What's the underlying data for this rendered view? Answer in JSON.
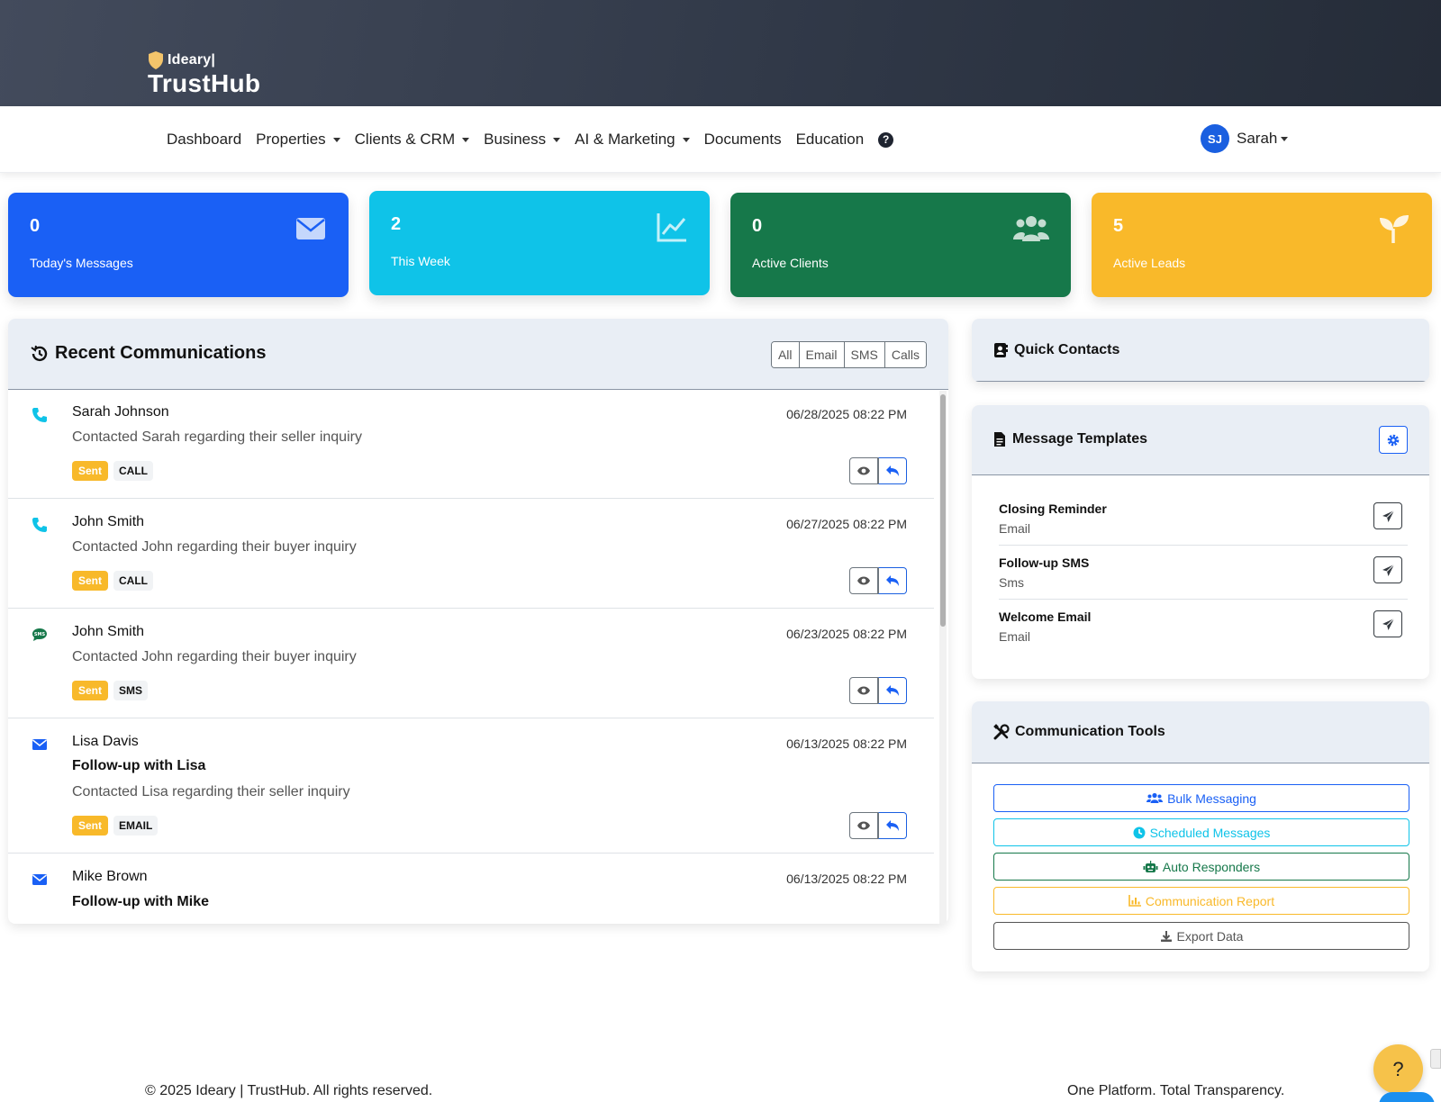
{
  "brand": {
    "small": "Ideary|",
    "big": "TrustHub"
  },
  "nav": {
    "items": [
      {
        "label": "Dashboard",
        "dropdown": false
      },
      {
        "label": "Properties",
        "dropdown": true
      },
      {
        "label": "Clients & CRM",
        "dropdown": true
      },
      {
        "label": "Business",
        "dropdown": true
      },
      {
        "label": "AI & Marketing",
        "dropdown": true
      },
      {
        "label": "Documents",
        "dropdown": false
      },
      {
        "label": "Education",
        "dropdown": false
      }
    ],
    "help": "?",
    "user": {
      "initials": "SJ",
      "name": "Sarah"
    }
  },
  "stats": [
    {
      "value": "0",
      "label": "Today's Messages",
      "color": "#1a60f5",
      "icon": "envelope-icon"
    },
    {
      "value": "2",
      "label": "This Week",
      "color": "#0fc3e8",
      "icon": "chart-line-icon"
    },
    {
      "value": "0",
      "label": "Active Clients",
      "color": "#16784a",
      "icon": "users-icon"
    },
    {
      "value": "5",
      "label": "Active Leads",
      "color": "#f9b92a",
      "icon": "seedling-icon"
    }
  ],
  "recent": {
    "title": "Recent Communications",
    "filters": [
      "All",
      "Email",
      "SMS",
      "Calls"
    ],
    "items": [
      {
        "type": "call",
        "name": "Sarah Johnson",
        "date": "06/28/2025 08:22 PM",
        "subject": "",
        "desc": "Contacted Sarah regarding their seller inquiry",
        "status": "Sent",
        "type_label": "CALL"
      },
      {
        "type": "call",
        "name": "John Smith",
        "date": "06/27/2025 08:22 PM",
        "subject": "",
        "desc": "Contacted John regarding their buyer inquiry",
        "status": "Sent",
        "type_label": "CALL"
      },
      {
        "type": "sms",
        "name": "John Smith",
        "date": "06/23/2025 08:22 PM",
        "subject": "",
        "desc": "Contacted John regarding their buyer inquiry",
        "status": "Sent",
        "type_label": "SMS"
      },
      {
        "type": "email",
        "name": "Lisa Davis",
        "date": "06/13/2025 08:22 PM",
        "subject": "Follow-up with Lisa",
        "desc": "Contacted Lisa regarding their seller inquiry",
        "status": "Sent",
        "type_label": "EMAIL"
      },
      {
        "type": "email",
        "name": "Mike Brown",
        "date": "06/13/2025 08:22 PM",
        "subject": "Follow-up with Mike",
        "desc": "",
        "status": "",
        "type_label": ""
      }
    ]
  },
  "quick_contacts": {
    "title": "Quick Contacts"
  },
  "templates": {
    "title": "Message Templates",
    "items": [
      {
        "name": "Closing Reminder",
        "type": "Email"
      },
      {
        "name": "Follow-up SMS",
        "type": "Sms"
      },
      {
        "name": "Welcome Email",
        "type": "Email"
      }
    ]
  },
  "tools": {
    "title": "Communication Tools",
    "buttons": [
      {
        "label": "Bulk Messaging",
        "color": "#1a60f5",
        "icon": "users-icon"
      },
      {
        "label": "Scheduled Messages",
        "color": "#0fc3e8",
        "icon": "clock-icon"
      },
      {
        "label": "Auto Responders",
        "color": "#16784a",
        "icon": "robot-icon"
      },
      {
        "label": "Communication Report",
        "color": "#f9b92a",
        "icon": "chart-bar-icon"
      },
      {
        "label": "Export Data",
        "color": "#555555",
        "icon": "download-icon"
      }
    ]
  },
  "footer": {
    "left": "© 2025 Ideary | TrustHub. All rights reserved.",
    "right": "One Platform. Total Transparency."
  },
  "help_fab": "?"
}
